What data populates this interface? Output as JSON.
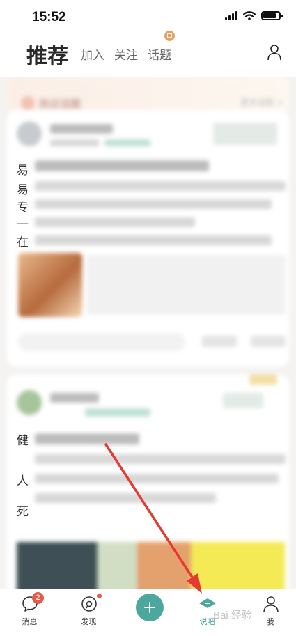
{
  "status_bar": {
    "time": "15:52"
  },
  "top_nav": {
    "tabs": [
      {
        "label": "推荐",
        "active": true
      },
      {
        "label": "加入"
      },
      {
        "label": "关注"
      },
      {
        "label": "话题"
      }
    ]
  },
  "hot_topics": {
    "title": "热议话题",
    "more": "更多话题 >"
  },
  "feed": {
    "card1_fragments": [
      "易",
      "易",
      "专",
      "一",
      "在"
    ],
    "card2_fragments": [
      "健",
      "人",
      "死"
    ]
  },
  "bottom_nav": {
    "items": [
      {
        "label": "消息",
        "badge": "2"
      },
      {
        "label": "发现"
      },
      {
        "label": ""
      },
      {
        "label": "说吧",
        "active": true
      },
      {
        "label": "我"
      }
    ]
  },
  "watermark": "Bai 经验",
  "colors": {
    "accent": "#4da79c",
    "badge": "#e45b4a",
    "annotation_arrow": "#e53a32"
  }
}
